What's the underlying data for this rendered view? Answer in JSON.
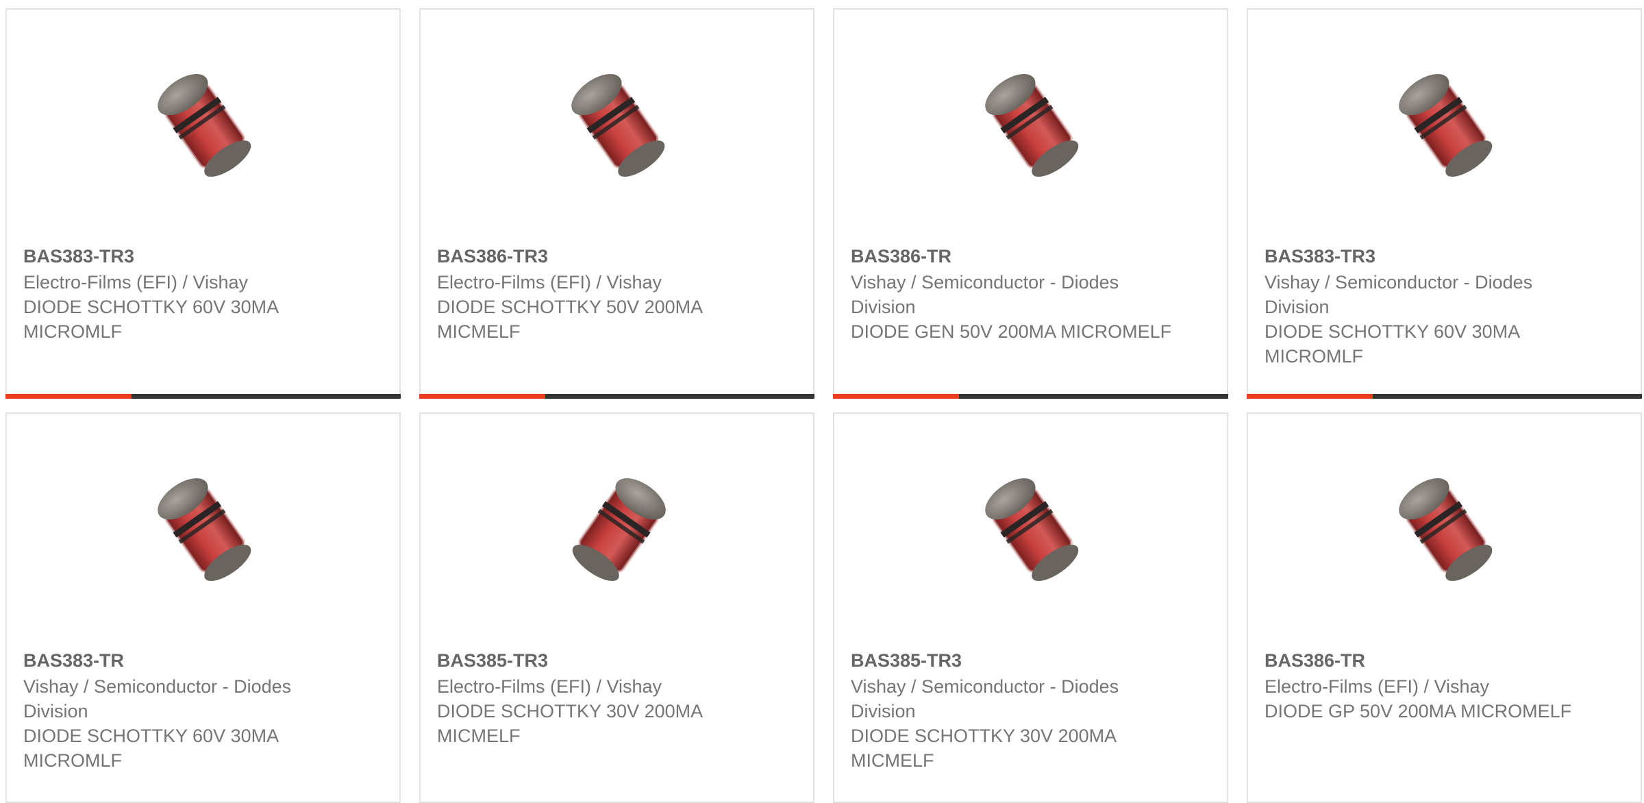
{
  "colors": {
    "accent": "#e8401d",
    "bar": "#333333",
    "border": "#e2e2e2",
    "part_text": "#666666",
    "body_text": "#757575"
  },
  "products": [
    {
      "part": "BAS383-TR3",
      "manufacturer": "Electro-Films (EFI) / Vishay",
      "description": "DIODE SCHOTTKY 60V 30MA MICROMLF",
      "image_icon": "diode-melf-icon"
    },
    {
      "part": "BAS386-TR3",
      "manufacturer": "Electro-Films (EFI) / Vishay",
      "description": "DIODE SCHOTTKY 50V 200MA MICMELF",
      "image_icon": "diode-melf-icon"
    },
    {
      "part": "BAS386-TR",
      "manufacturer": "Vishay / Semiconductor - Diodes Division",
      "description": "DIODE GEN 50V 200MA MICROMELF",
      "image_icon": "diode-melf-icon"
    },
    {
      "part": "BAS383-TR3",
      "manufacturer": "Vishay / Semiconductor - Diodes Division",
      "description": "DIODE SCHOTTKY 60V 30MA MICROMLF",
      "image_icon": "diode-melf-icon"
    },
    {
      "part": "BAS383-TR",
      "manufacturer": "Vishay / Semiconductor - Diodes Division",
      "description": "DIODE SCHOTTKY 60V 30MA MICROMLF",
      "image_icon": "diode-melf-icon"
    },
    {
      "part": "BAS385-TR3",
      "manufacturer": "Electro-Films (EFI) / Vishay",
      "description": "DIODE SCHOTTKY 30V 200MA MICMELF",
      "image_icon": "diode-melf-icon"
    },
    {
      "part": "BAS385-TR3",
      "manufacturer": "Vishay / Semiconductor - Diodes Division",
      "description": "DIODE SCHOTTKY 30V 200MA MICMELF",
      "image_icon": "diode-melf-icon"
    },
    {
      "part": "BAS386-TR",
      "manufacturer": "Electro-Films (EFI) / Vishay",
      "description": "DIODE GP 50V 200MA MICROMELF",
      "image_icon": "diode-melf-icon"
    }
  ]
}
